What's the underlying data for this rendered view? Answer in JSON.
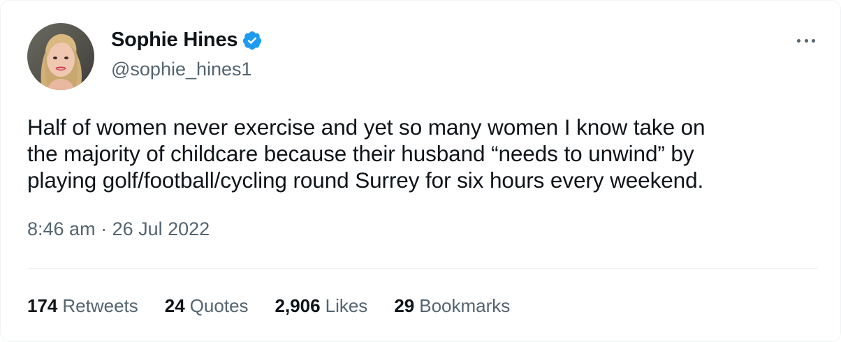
{
  "author": {
    "display_name": "Sophie Hines",
    "handle": "@sophie_hines1",
    "verified": true,
    "avatar": "profile-photo"
  },
  "menu_icon": "more-dots-icon",
  "tweet": {
    "lines": [
      "Half of women never exercise and yet so many women I know take on",
      "the majority of childcare because their husband “needs to unwind” by",
      "playing golf/football/cycling round Surrey for six hours every weekend."
    ],
    "time": "8:46 am",
    "separator": " · ",
    "date": "26 Jul 2022"
  },
  "stats": [
    {
      "count": "174",
      "label": "Retweets"
    },
    {
      "count": "24",
      "label": "Quotes"
    },
    {
      "count": "2,906",
      "label": "Likes"
    },
    {
      "count": "29",
      "label": "Bookmarks"
    }
  ],
  "colors": {
    "text_primary": "#0f1419",
    "text_secondary": "#536471",
    "verified_blue": "#1d9bf0",
    "divider": "#eff3f4"
  }
}
